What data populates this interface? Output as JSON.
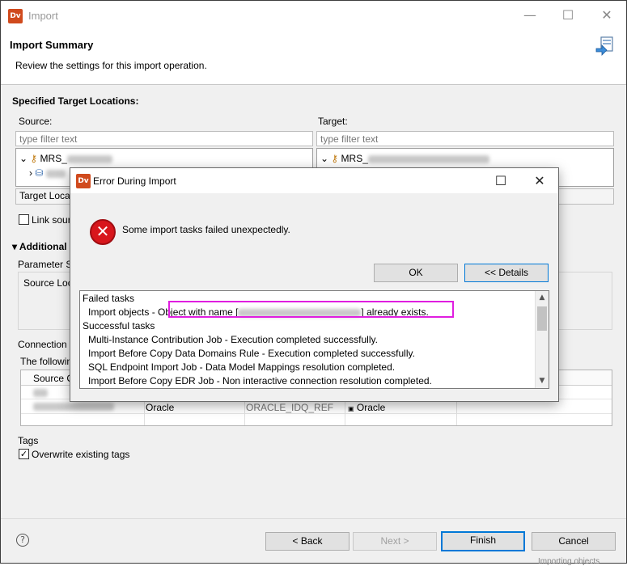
{
  "window": {
    "title": "Import",
    "minimize_glyph": "—",
    "maximize_glyph": "☐",
    "close_glyph": "✕",
    "app_icon_text": "Dv"
  },
  "header": {
    "title": "Import Summary",
    "subtitle": "Review the settings for this import operation."
  },
  "targets": {
    "section_title": "Specified Target Locations:",
    "source_label": "Source:",
    "target_label": "Target:",
    "filter_placeholder": "type filter text",
    "source_tree_root": "MRS_",
    "target_tree_root": "MRS_",
    "target_location_label": "Target Locat",
    "link_source_label": "Link sour"
  },
  "additional": {
    "section_title": "Additional",
    "parameter_label": "Parameter S",
    "source_loc_label": "Source Loc"
  },
  "connection": {
    "label": "Connection",
    "following_label": "The followin",
    "table_header_source": "Source C",
    "row2_type": "Oracle",
    "row2_partial": "ORACLE_IDQ_REF",
    "row2_target_type": "Oracle"
  },
  "tags": {
    "label": "Tags",
    "overwrite_label": "Overwrite existing tags",
    "overwrite_checked": true
  },
  "footer": {
    "help_glyph": "?",
    "back_label": "< Back",
    "next_label": "Next >",
    "finish_label": "Finish",
    "cancel_label": "Cancel",
    "bottom_partial": "Importing objects"
  },
  "dialog": {
    "title": "Error During Import",
    "message": "Some import tasks failed unexpectedly.",
    "ok_label": "OK",
    "details_label": "<< Details",
    "details": {
      "failed_header": "Failed tasks",
      "failed_item_prefix": "Import objects - ",
      "failed_item_msg_start": "Object with name [",
      "failed_item_msg_end": "] already exists.",
      "success_header": "Successful tasks",
      "success_items": [
        "Multi-Instance Contribution Job - Execution completed successfully.",
        "Import Before Copy Data Domains Rule - Execution completed successfully.",
        "SQL Endpoint Import Job - Data Model Mappings resolution completed.",
        "Import Before Copy EDR Job - Non interactive connection resolution completed."
      ]
    }
  },
  "colors": {
    "accent": "#0078d7",
    "highlight": "#e01ee0",
    "error": "#d8161c",
    "app_icon": "#d04a1d"
  }
}
